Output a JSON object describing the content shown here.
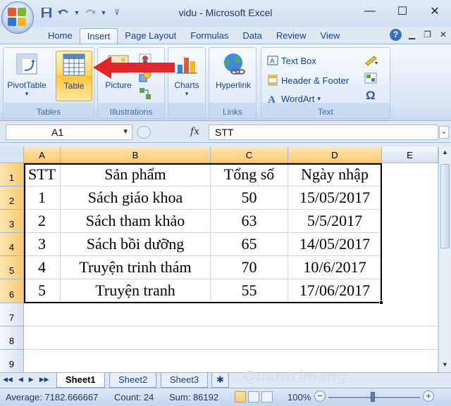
{
  "window": {
    "title": "vidu - Microsoft Excel",
    "minimize": "—",
    "maximize": "☐",
    "close": "✕"
  },
  "qat": {
    "save": "💾",
    "undo": "↶",
    "redo": "↷"
  },
  "tabs": [
    "Home",
    "Insert",
    "Page Layout",
    "Formulas",
    "Data",
    "Review",
    "View"
  ],
  "active_tab": "Insert",
  "help": "?",
  "ribbon": {
    "groups": {
      "tables": {
        "label": "Tables",
        "pivot": "PivotTable",
        "table": "Table"
      },
      "illustrations": {
        "label": "Illustrations",
        "picture": "Picture"
      },
      "charts": {
        "label": "",
        "charts": "Charts"
      },
      "links": {
        "label": "Links",
        "hyperlink": "Hyperlink"
      },
      "text": {
        "label": "Text",
        "textbox": "Text Box",
        "header_footer": "Header & Footer",
        "wordart": "WordArt"
      }
    }
  },
  "formula_bar": {
    "name_box": "A1",
    "fx": "fx",
    "value": "STT"
  },
  "grid": {
    "columns": [
      "A",
      "B",
      "C",
      "D",
      "E"
    ],
    "rows": [
      "1",
      "2",
      "3",
      "4",
      "5",
      "6",
      "7",
      "8",
      "9"
    ],
    "header": [
      "STT",
      "Sản phẩm",
      "Tổng số",
      "Ngày nhập"
    ],
    "data": [
      [
        "1",
        "Sách giáo khoa",
        "50",
        "15/05/2017"
      ],
      [
        "2",
        "Sách tham khảo",
        "63",
        "5/5/2017"
      ],
      [
        "3",
        "Sách bồi dưỡng",
        "65",
        "14/05/2017"
      ],
      [
        "4",
        "Truyện trinh thám",
        "70",
        "10/6/2017"
      ],
      [
        "5",
        "Truyện tranh",
        "55",
        "17/06/2017"
      ]
    ]
  },
  "sheets": [
    "Sheet1",
    "Sheet2",
    "Sheet3"
  ],
  "active_sheet": "Sheet1",
  "watermark": "Quantrimang",
  "status": {
    "average": "Average: 7182.666667",
    "count": "Count: 24",
    "sum": "Sum: 86192",
    "zoom": "100%"
  },
  "colors": {
    "arrow": "#e4262c",
    "selected_button": "#ffc53a",
    "ribbon": "#dfe9f5"
  }
}
